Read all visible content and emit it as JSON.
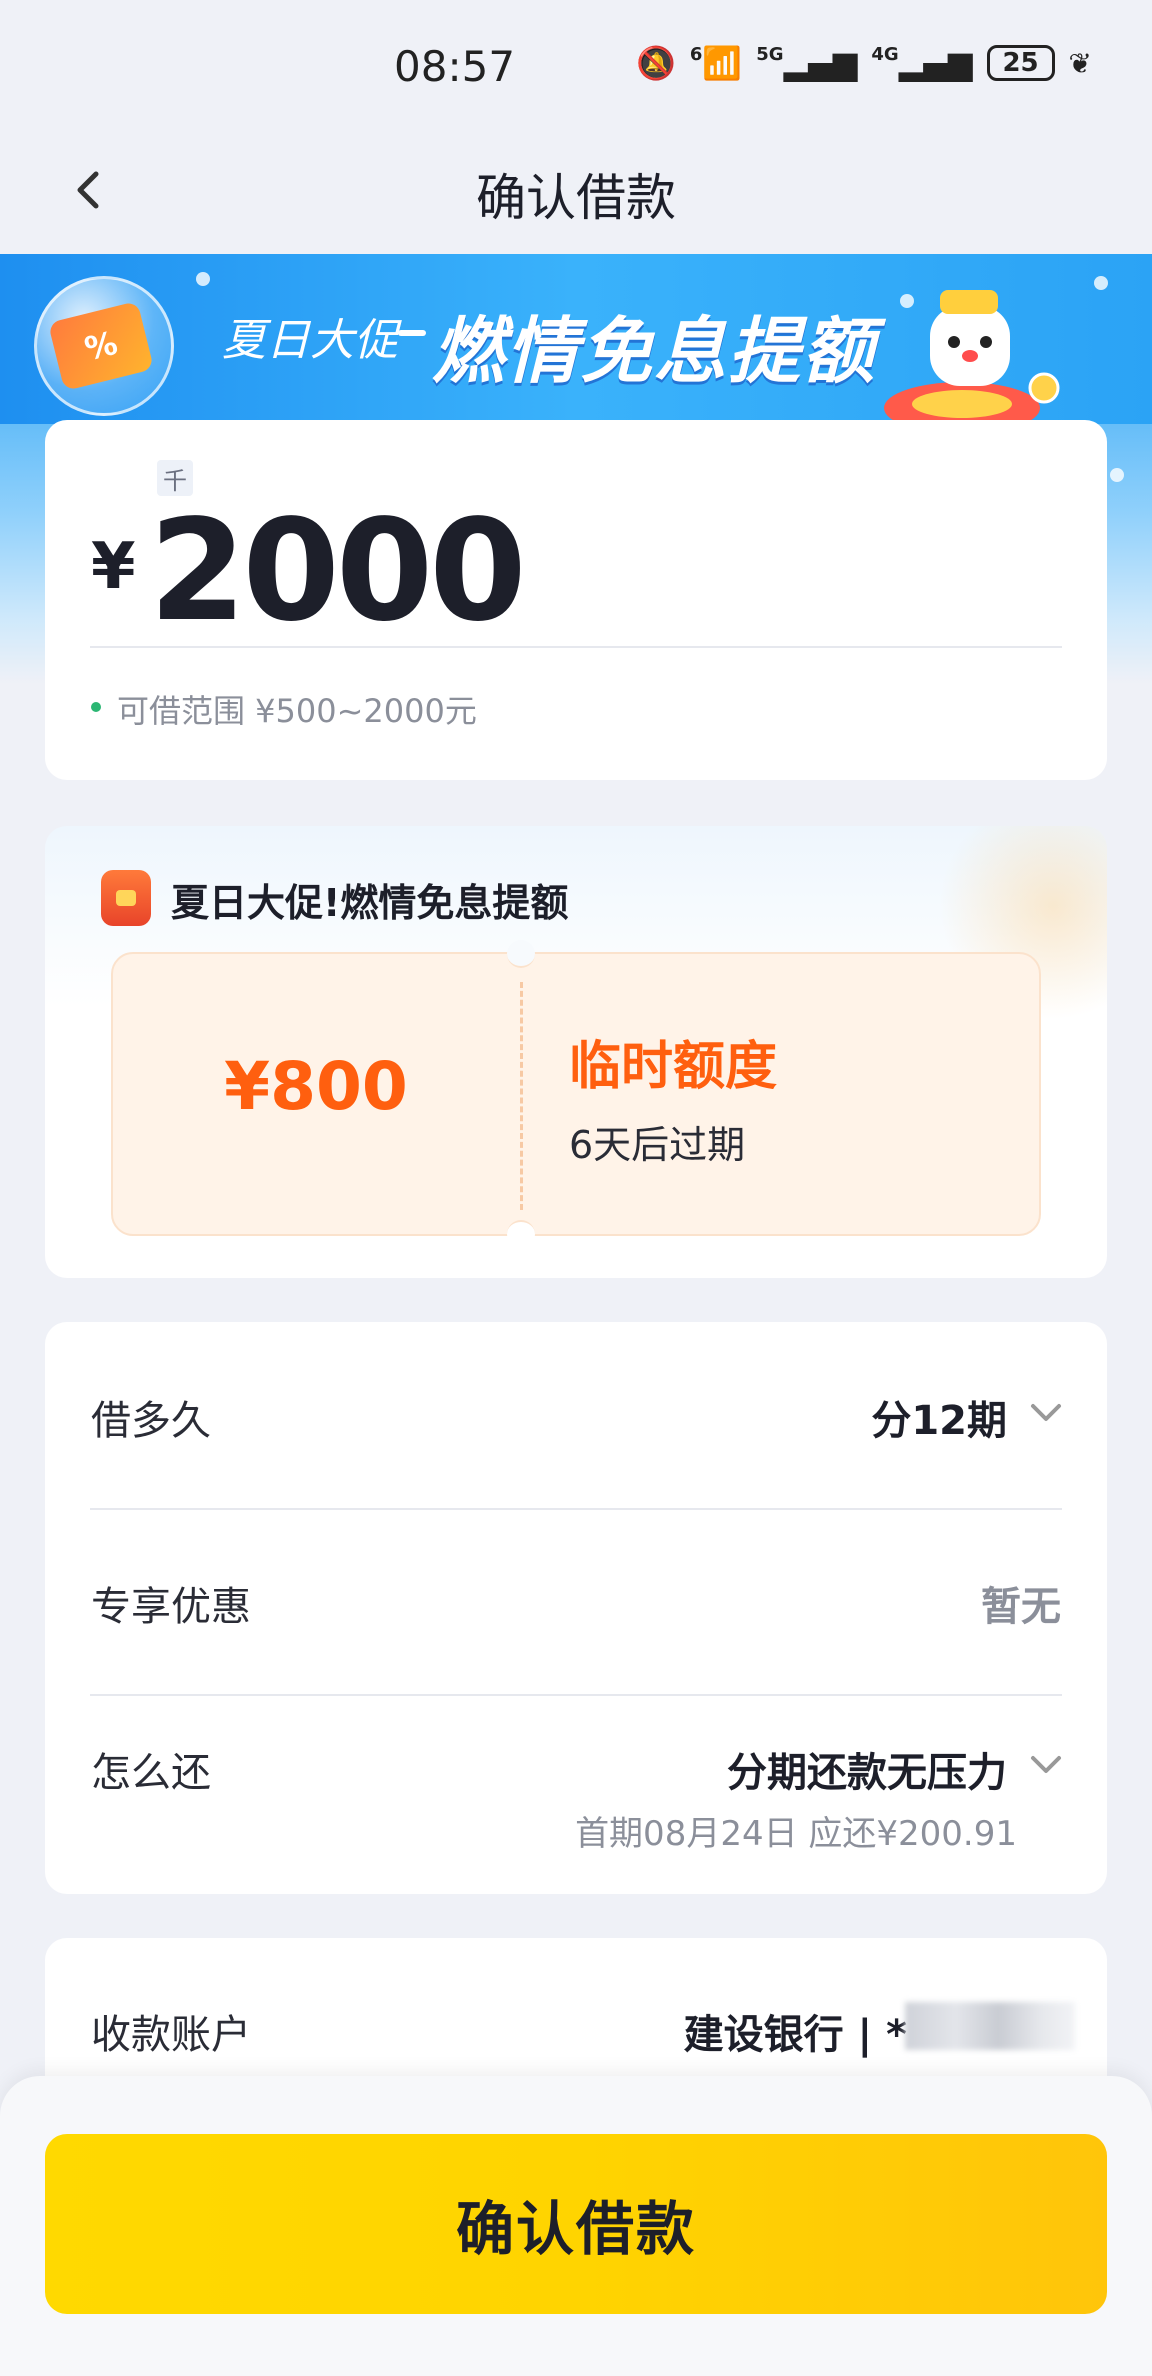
{
  "status_bar": {
    "time": "08:57",
    "net1": "6",
    "net2": "5G",
    "net3": "4G",
    "battery": "25"
  },
  "nav": {
    "title": "确认借款"
  },
  "banner": {
    "small_text": "夏日大促",
    "big_text": "燃情免息提额",
    "coupon_symbol": "%"
  },
  "amount": {
    "unit": "千",
    "currency": "¥",
    "value": "2000",
    "range_text": "可借范围 ¥500~2000元"
  },
  "promo": {
    "title": "夏日大促!燃情免息提额",
    "ticket_amount": "¥800",
    "ticket_label": "临时额度",
    "ticket_expire": "6天后过期"
  },
  "details": {
    "term_label": "借多久",
    "term_value": "分12期",
    "offer_label": "专享优惠",
    "offer_value": "暂无",
    "repay_label": "怎么还",
    "repay_value": "分期还款无压力",
    "repay_note": "首期08月24日 应还¥200.91"
  },
  "account": {
    "label": "收款账户",
    "bank": "建设银行 | *"
  },
  "footer": {
    "confirm_label": "确认借款"
  },
  "colors": {
    "accent_orange": "#ff5f0f",
    "button_yellow": "#ffd400",
    "banner_blue": "#2a9df4"
  }
}
